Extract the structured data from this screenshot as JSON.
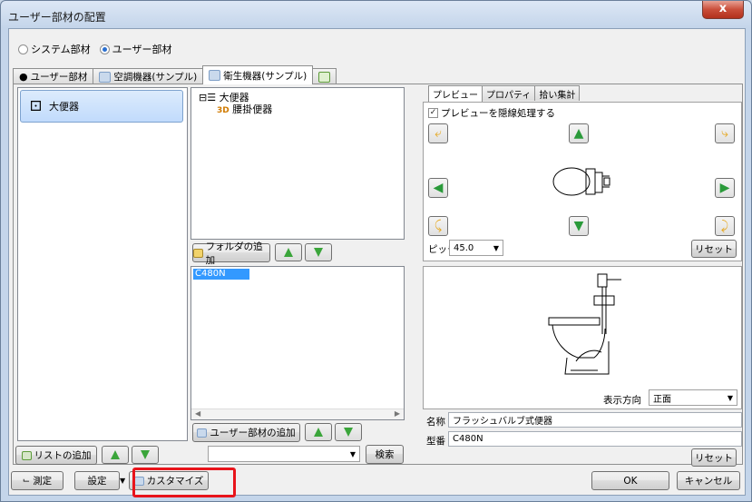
{
  "window": {
    "title": "ユーザー部材の配置",
    "close_label": "x"
  },
  "radios": [
    {
      "label": "システム部材",
      "checked": false
    },
    {
      "label": "ユーザー部材",
      "checked": true
    }
  ],
  "tabs": [
    {
      "label": "ユーザー部材",
      "active": false
    },
    {
      "label": "空調機器(サンプル)",
      "active": false
    },
    {
      "label": "衛生機器(サンプル)",
      "active": true
    },
    {
      "label": "",
      "active": false
    }
  ],
  "left_list": {
    "selected_item": "大便器",
    "add_button": "リストの追加"
  },
  "tree": {
    "root": "大便器",
    "child": "腰掛便器",
    "add_folder_button": "フォルダの追加"
  },
  "parts_list": {
    "selected_item": "C480N",
    "add_button": "ユーザー部材の追加"
  },
  "search": {
    "value": "",
    "button": "検索"
  },
  "right_tabs": [
    {
      "label": "プレビュー",
      "active": true
    },
    {
      "label": "プロパティ",
      "active": false
    },
    {
      "label": "拾い集計",
      "active": false
    }
  ],
  "preview": {
    "hidden_line_label": "プレビューを隠線処理する",
    "hidden_line_checked": true,
    "pitch_label": "ピッチ",
    "pitch_value": "45.0",
    "reset_button": "リセット",
    "view_dir_label": "表示方向",
    "view_dir_value": "正面"
  },
  "info": {
    "name_label": "名称",
    "name_value": "フラッシュバルブ式便器",
    "model_label": "型番",
    "model_value": "C480N",
    "reset_button": "リセット"
  },
  "footer": {
    "measure_button": "測定",
    "settings_button": "設定",
    "customize_button": "カスタマイズ",
    "ok_button": "OK",
    "cancel_button": "キャンセル"
  }
}
